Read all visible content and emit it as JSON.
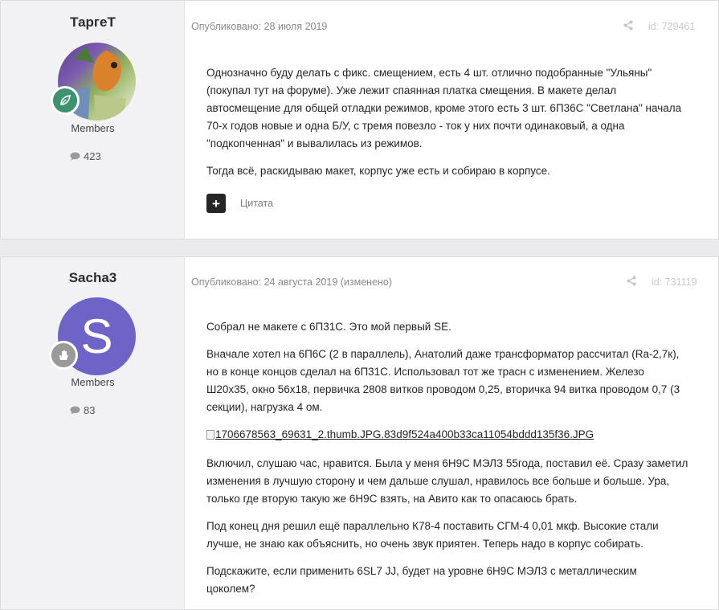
{
  "posts": [
    {
      "author": "ТаргеТ",
      "group": "Members",
      "post_count": "423",
      "published": "Опубликовано: 28 июля 2019",
      "post_id": "id: 729461",
      "paragraphs": [
        "Однозначно буду делать с фикс. смещением, есть 4 шт. отлично подобранные \"Ульяны\" (покупал тут на форуме). Уже лежит спаянная платка смещения. В макете делал автосмещение для общей отладки режимов, кроме этого есть 3 шт. 6П36С \"Светлана\" начала 70-х годов новые и одна Б/У, с тремя повезло - ток у них почти одинаковый, а одна \"подкопченная\" и  вывалилась из режимов.",
        "Тогда всё, раскидываю макет, корпус уже есть и собираю в корпусе."
      ],
      "quote_label": "Цитата",
      "badge_color": "#3d9270",
      "badge_icon": "leaf-icon"
    },
    {
      "author": "Sacha3",
      "group": "Members",
      "post_count": "83",
      "avatar_letter": "S",
      "avatar_color": "#6e63c6",
      "published": "Опубликовано: 24 августа 2019 (изменено)",
      "post_id": "id: 731119",
      "paragraphs": [
        "Собрал не макете с 6П31С. Это мой первый SE.",
        "Вначале хотел на 6П6С (2 в параллель), Анатолий даже трансформатор рассчитал (Ra-2,7к), но в конце концов сделал на 6П31С. Использовал тот же трасн с изменением. Железо Ш20х35, окно 56х18, первичка 2808 витков проводом 0,25, вторичка 94 витка проводом 0,7 (3 секции), нагрузка 4 ом.",
        "Включил, слушаю час, нравится. Была у меня 6Н9С МЭЛЗ 55года, поставил её. Сразу заметил изменения в лучшую сторону и чем дальше слушал, нравилось все больше и больше. Ура, только где вторую такую же 6Н9С взять, на Авито как то опасаюсь брать.",
        "Под конец дня решил ещё параллельно К78-4 поставить СГМ-4 0,01 мкф. Высокие стали лучше, не знаю как объяснить, но очень звук приятен. Теперь надо в корпус собирать.",
        "Подскажите, если применить 6SL7 JJ, будет на уровне 6Н9С МЭЛЗ с металлическим цоколем?"
      ],
      "image_link": "1706678563_69631_2.thumb.JPG.83d9f524a400b33ca11054bddd135f36.JPG",
      "badge_color": "#9a9a9a",
      "badge_icon": "hand-icon"
    }
  ],
  "icons": {
    "share": "share-icon",
    "comment": "comment-icon",
    "quote_add": "plus-icon"
  }
}
